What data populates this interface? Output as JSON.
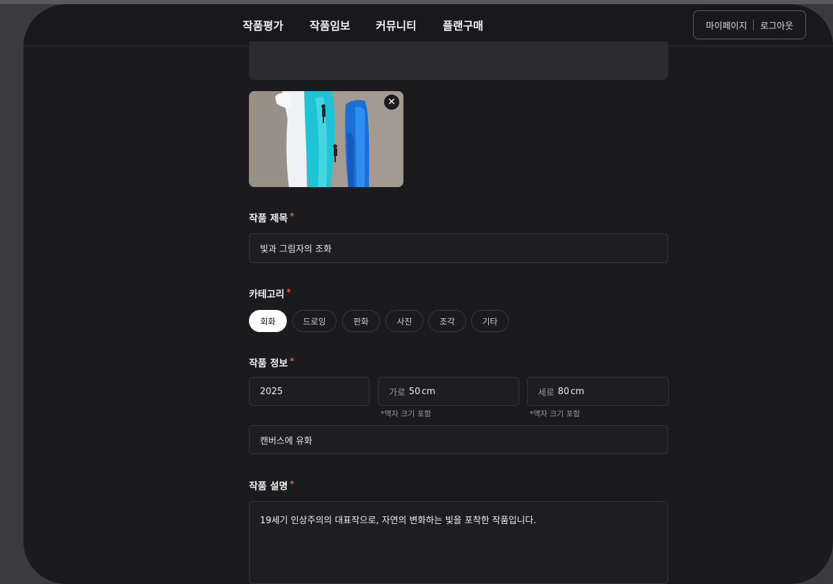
{
  "nav": {
    "tabs": [
      {
        "label": "작품평가",
        "active": false
      },
      {
        "label": "작품임보",
        "active": true
      },
      {
        "label": "커뮤니티",
        "active": false
      },
      {
        "label": "플랜구매",
        "active": false
      }
    ],
    "mypage": "마이페이지",
    "logout": "로그아웃"
  },
  "form": {
    "title_label": "작품 제목",
    "title_value": "빛과 그림자의 조화",
    "category_label": "카테고리",
    "categories": [
      {
        "label": "회화",
        "selected": true
      },
      {
        "label": "드로잉",
        "selected": false
      },
      {
        "label": "판화",
        "selected": false
      },
      {
        "label": "사진",
        "selected": false
      },
      {
        "label": "조각",
        "selected": false
      },
      {
        "label": "기타",
        "selected": false
      }
    ],
    "info_label": "작품 정보",
    "year": "2025",
    "width_prefix": "가로",
    "width_value": "50",
    "height_prefix": "세로",
    "height_value": "80",
    "unit": "cm",
    "frame_hint": "*액자 크기 포함",
    "medium": "캔버스에 유화",
    "desc_label": "작품 설명",
    "desc_value": "19세기 인상주의의 대표작으로, 자연의 변화하는 빛을 포착한 작품입니다.",
    "required_mark": "*"
  },
  "colors": {
    "background": "#1b1b1e",
    "required": "#ff4d4d",
    "chip_active": "#ffffff"
  }
}
